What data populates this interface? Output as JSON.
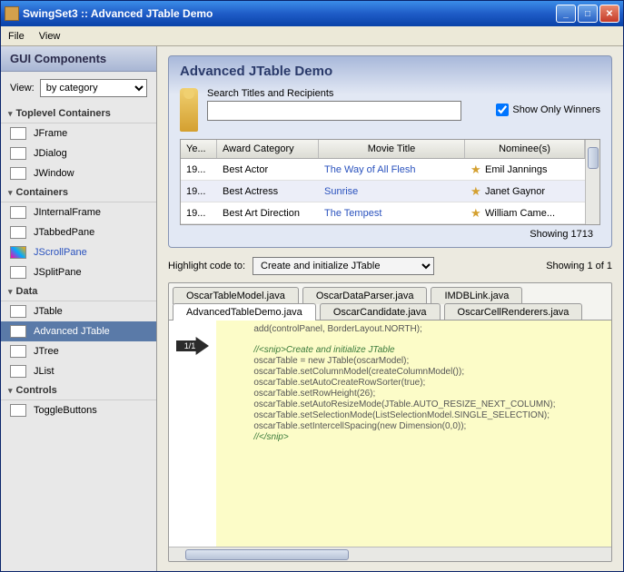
{
  "window": {
    "title": "SwingSet3 :: Advanced JTable Demo"
  },
  "menu": {
    "file": "File",
    "view": "View"
  },
  "sidebar": {
    "title": "GUI Components",
    "view_label": "View:",
    "view_select": "by category",
    "categories": [
      {
        "name": "Toplevel Containers",
        "items": [
          "JFrame",
          "JDialog",
          "JWindow"
        ]
      },
      {
        "name": "Containers",
        "items": [
          "JInternalFrame",
          "JTabbedPane",
          "JScrollPane",
          "JSplitPane"
        ]
      },
      {
        "name": "Data",
        "items": [
          "JTable",
          "Advanced JTable",
          "JTree",
          "JList"
        ]
      },
      {
        "name": "Controls",
        "items": [
          "ToggleButtons"
        ]
      }
    ]
  },
  "demo": {
    "title": "Advanced JTable Demo",
    "search_label": "Search Titles and Recipients",
    "only_winners": "Show Only Winners",
    "columns": {
      "year": "Ye...",
      "category": "Award Category",
      "title": "Movie Title",
      "nominee": "Nominee(s)"
    },
    "rows": [
      {
        "year": "19...",
        "category": "Best Actor",
        "title": "The Way of All Flesh",
        "nominee": "Emil Jannings"
      },
      {
        "year": "19...",
        "category": "Best Actress",
        "title": "Sunrise",
        "nominee": "Janet Gaynor"
      },
      {
        "year": "19...",
        "category": "Best Art Direction",
        "title": "The Tempest",
        "nominee": "William Came..."
      }
    ],
    "showing": "Showing 1713"
  },
  "highlight": {
    "label": "Highlight code to:",
    "value": "Create and initialize JTable",
    "showing": "Showing 1 of 1"
  },
  "tabs": {
    "row1": [
      "OscarTableModel.java",
      "OscarDataParser.java",
      "IMDBLink.java"
    ],
    "row2": [
      "AdvancedTableDemo.java",
      "OscarCandidate.java",
      "OscarCellRenderers.java"
    ],
    "active": "AdvancedTableDemo.java"
  },
  "code": {
    "marker": "1/1",
    "pre": "            add(controlPanel, BorderLayout.NORTH);\n",
    "comment1": "            //<snip>Create and initialize JTable",
    "body": "            oscarTable = new JTable(oscarModel);\n            oscarTable.setColumnModel(createColumnModel());\n            oscarTable.setAutoCreateRowSorter(true);\n            oscarTable.setRowHeight(26);\n            oscarTable.setAutoResizeMode(JTable.AUTO_RESIZE_NEXT_COLUMN);\n            oscarTable.setSelectionMode(ListSelectionModel.SINGLE_SELECTION);\n            oscarTable.setIntercellSpacing(new Dimension(0,0));",
    "comment2": "            //</snip>"
  }
}
